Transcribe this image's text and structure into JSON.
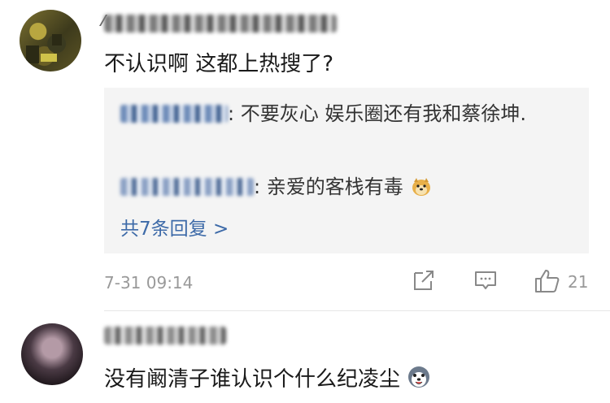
{
  "comments": [
    {
      "content": "不认识啊 这都上热搜了?",
      "replies": [
        {
          "text": "不要灰心 娱乐圈还有我和蔡徐坤."
        },
        {
          "text": "亲爱的客栈有毒"
        }
      ],
      "more_replies": "共7条回复 >",
      "timestamp": "7-31 09:14",
      "like_count": "21"
    },
    {
      "content": "没有阚清子谁认识个什么纪凌尘"
    }
  ],
  "icons": {
    "share": "share-icon",
    "comment": "comment-icon",
    "like": "thumbs-up-icon",
    "emoji_doge": "doge-emoji",
    "emoji_husky": "husky-emoji"
  },
  "colors": {
    "link": "#3d6aa8",
    "meta": "#999999",
    "reply_bg": "#f4f4f4"
  }
}
